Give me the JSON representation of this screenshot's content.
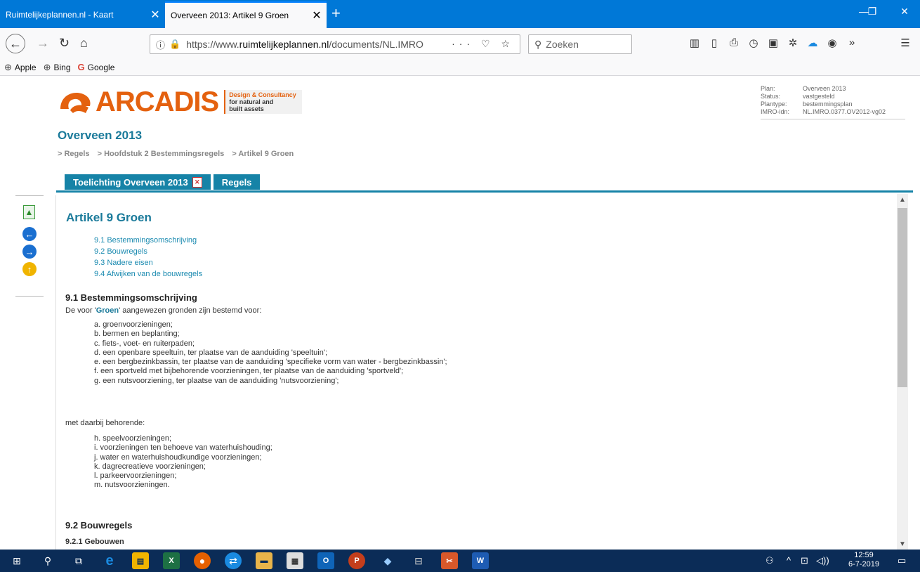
{
  "browser": {
    "tabs": [
      {
        "title": "Ruimtelijkeplannen.nl - Kaart",
        "active": false
      },
      {
        "title": "Overveen 2013: Artikel 9 Groen",
        "active": true
      }
    ],
    "new_tab_icon": "plus-icon",
    "url_prefix": "https://www.",
    "url_domain": "ruimtelijkeplannen.nl",
    "url_path": "/documents/NL.IMRO",
    "search_placeholder": "Zoeken",
    "bookmarks": [
      {
        "label": "Apple",
        "icon": "globe-icon"
      },
      {
        "label": "Bing",
        "icon": "globe-icon"
      },
      {
        "label": "Google",
        "icon": "google-icon"
      }
    ]
  },
  "logo": {
    "word": "ARCADIS",
    "tag1": "Design & Consultancy",
    "tag2": "for natural and",
    "tag3": "built assets",
    "color": "#e4610f"
  },
  "planinfo": {
    "plan_label": "Plan:",
    "plan_value": "Overveen 2013",
    "status_label": "Status:",
    "status_value": "vastgesteld",
    "type_label": "Plantype:",
    "type_value": "bestemmingsplan",
    "imro_label": "IMRO-idn:",
    "imro_value": "NL.IMRO.0377.OV2012-vg02"
  },
  "page": {
    "plan_title": "Overveen 2013",
    "breadcrumbs": [
      "> Regels",
      "> Hoofdstuk 2 Bestemmingsregels",
      "> Artikel 9 Groen"
    ],
    "tabs": [
      {
        "label": "Toelichting Overveen 2013"
      },
      {
        "label": "Regels"
      }
    ],
    "accent": "#1683a7"
  },
  "article": {
    "title": "Artikel 9 Groen",
    "toc": [
      "9.1 Bestemmingsomschrijving",
      "9.2 Bouwregels",
      "9.3 Nadere eisen",
      "9.4 Afwijken van de bouwregels"
    ],
    "s1_title": "9.1 Bestemmingsomschrijving",
    "s1_intro_pre": "De voor '",
    "s1_intro_hl": "Groen",
    "s1_intro_post": "' aangewezen gronden zijn bestemd voor:",
    "list1": [
      "a. groenvoorzieningen;",
      "b. bermen en beplanting;",
      "c. fiets-, voet- en ruiterpaden;",
      "d. een openbare speeltuin, ter plaatse van de aanduiding 'speeltuin';",
      "e. een bergbezinkbassin, ter plaatse van de aanduiding 'specifieke vorm van water - bergbezinkbassin';",
      "f. een sportveld met bijbehorende voorzieningen, ter plaatse van de aanduiding 'sportveld';",
      "g. een nutsvoorziening, ter plaatse van de aanduiding 'nutsvoorziening';"
    ],
    "s1_middle": "met daarbij behorende:",
    "list2": [
      "h. speelvoorzieningen;",
      "i. voorzieningen ten behoeve van waterhuishouding;",
      "j. water en waterhuishoudkundige voorzieningen;",
      "k. dagrecreatieve voorzieningen;",
      "l. parkeervoorzieningen;",
      "m. nutsvoorzieningen."
    ],
    "s2_title": "9.2 Bouwregels",
    "s2_sub": "9.2.1 Gebouwen"
  },
  "taskbar": {
    "time": "12:59",
    "date": "6-7-2019"
  }
}
